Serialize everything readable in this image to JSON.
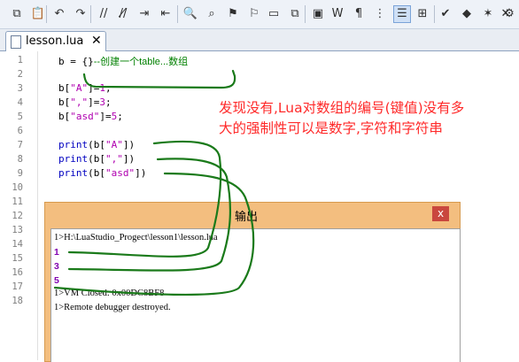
{
  "toolbar": {
    "buttons": [
      {
        "name": "copy-icon",
        "glyph": "⧉"
      },
      {
        "name": "paste-icon",
        "glyph": "📋"
      },
      {
        "name": "undo-icon",
        "glyph": "↶"
      },
      {
        "name": "redo-icon",
        "glyph": "↷"
      },
      {
        "name": "comment-icon",
        "glyph": "//"
      },
      {
        "name": "uncomment-icon",
        "glyph": "//̸"
      },
      {
        "name": "indent-icon",
        "glyph": "⇥"
      },
      {
        "name": "outdent-icon",
        "glyph": "⇤"
      },
      {
        "name": "find-icon",
        "glyph": "🔍"
      },
      {
        "name": "find-next-icon",
        "glyph": "⌕"
      },
      {
        "name": "bookmark-icon",
        "glyph": "⚑"
      },
      {
        "name": "bookmark-next-icon",
        "glyph": "⚐"
      },
      {
        "name": "window-icon",
        "glyph": "▭"
      },
      {
        "name": "windows-icon",
        "glyph": "⧉"
      },
      {
        "name": "panel-icon",
        "glyph": "▣"
      },
      {
        "name": "word-wrap-icon",
        "glyph": "W"
      },
      {
        "name": "show-whitespace-icon",
        "glyph": "¶"
      },
      {
        "name": "line-numbers-icon",
        "glyph": "⋮"
      },
      {
        "name": "outline-icon",
        "glyph": "☰"
      },
      {
        "name": "structure-icon",
        "glyph": "⊞"
      },
      {
        "name": "check-icon",
        "glyph": "✔"
      },
      {
        "name": "breakpoint-icon",
        "glyph": "◆"
      },
      {
        "name": "breakpoint-add-icon",
        "glyph": "✶"
      },
      {
        "name": "breakpoint-remove-icon",
        "glyph": "✕"
      },
      {
        "name": "breakpoint-clear-icon",
        "glyph": "⚙"
      }
    ]
  },
  "tab": {
    "label": "lesson.lua",
    "close": "✕"
  },
  "editor": {
    "line_numbers": [
      "1",
      "2",
      "3",
      "4",
      "5",
      "6",
      "7",
      "8",
      "9",
      "10",
      "11",
      "12",
      "13",
      "14",
      "15",
      "16",
      "17",
      "18"
    ],
    "lines": {
      "l1_code": "b = {}",
      "l1_comment": "--创建一个table...数组",
      "l3_a": "b[",
      "l3_s": "\"A\"",
      "l3_b": "]=",
      "l3_n": "1",
      "l3_c": ";",
      "l4_a": "b[",
      "l4_s": "\",\"",
      "l4_b": "]=",
      "l4_n": "3",
      "l4_c": ";",
      "l5_a": "b[",
      "l5_s": "\"asd\"",
      "l5_b": "]=",
      "l5_n": "5",
      "l5_c": ";",
      "l7_f": "print",
      "l7_a": "(b[",
      "l7_s": "\"A\"",
      "l7_b": "])",
      "l8_f": "print",
      "l8_a": "(b[",
      "l8_s": "\",\"",
      "l8_b": "])",
      "l9_f": "print",
      "l9_a": "(b[",
      "l9_s": "\"asd\"",
      "l9_b": "])"
    },
    "annotation_line1": "发现没有,Lua对数组的编号(键值)没有多",
    "annotation_line2": "大的强制性可以是数字,字符和字符串"
  },
  "output": {
    "title": "输出",
    "close": "x",
    "lines": {
      "path": "1>H:\\LuaStudio_Progect\\lesson1\\lesson.lua",
      "v1": "1",
      "v2": "3",
      "v3": "5",
      "closed": "1>VM Closed: 0x00DC8BF8",
      "destroyed": "1>Remote debugger destroyed."
    }
  },
  "colors": {
    "annotation": "#ff2a2a",
    "scribble": "#1a7a1a",
    "output_header": "#f3be7f",
    "close_button": "#c9473e"
  }
}
